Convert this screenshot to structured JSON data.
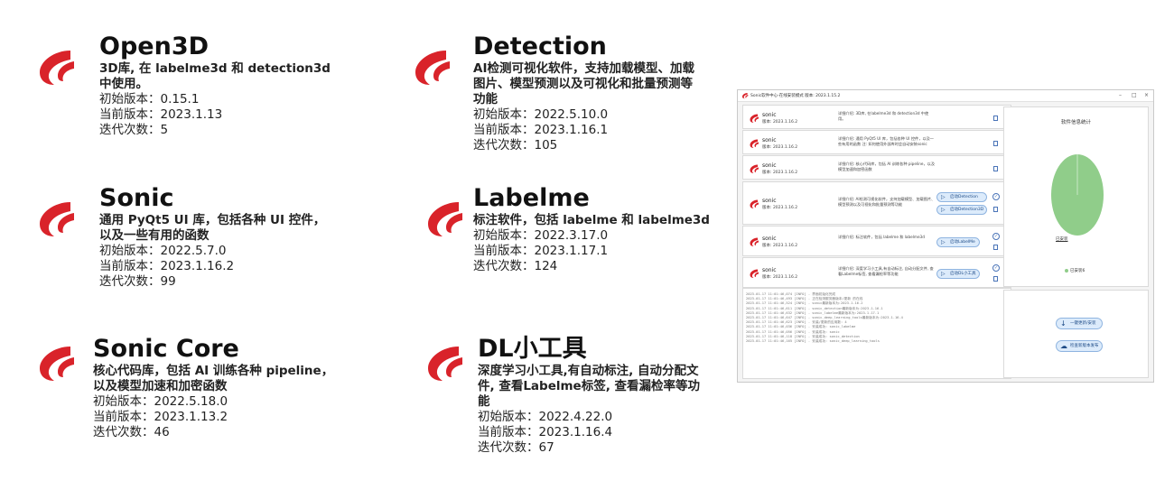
{
  "showcase": [
    {
      "title": "Open3D",
      "desc": "3D库, 在 labelme3d 和 detection3d 中使用。",
      "init_version": "初始版本：0.15.1",
      "current_version": "当前版本：2023.1.13",
      "iterations": "迭代次数：5"
    },
    {
      "title": "Detection",
      "desc": "AI检测可视化软件，支持加载模型、加载图片、模型预测以及可视化和批量预测等功能",
      "init_version": "初始版本：2022.5.10.0",
      "current_version": "当前版本：2023.1.16.1",
      "iterations": "迭代次数：105"
    },
    {
      "title": "Sonic",
      "desc": "通用 PyQt5 UI 库，包括各种 UI 控件，以及一些有用的函数",
      "init_version": "初始版本：2022.5.7.0",
      "current_version": "当前版本：2023.1.16.2",
      "iterations": "迭代次数：99"
    },
    {
      "title": "Labelme",
      "desc": "标注软件，包括 labelme 和 labelme3d",
      "init_version": "初始版本：2022.3.17.0",
      "current_version": "当前版本：2023.1.17.1",
      "iterations": "迭代次数：124"
    },
    {
      "title": "Sonic Core",
      "desc": "核心代码库，包括 AI 训练各种 pipeline，以及模型加速和加密函数",
      "init_version": "初始版本：2022.5.18.0",
      "current_version": "当前版本：2023.1.13.2",
      "iterations": "迭代次数：46"
    },
    {
      "title": "DL小工具",
      "desc": "深度学习小工具,有自动标注, 自动分配文件, 查看Labelme标签, 查看漏检率等功能",
      "init_version": "初始版本：2022.4.22.0",
      "current_version": "当前版本：2023.1.16.4",
      "iterations": "迭代次数：67"
    }
  ],
  "window": {
    "title": "Sonic软件中心-在线安装模式    版本: 2023.1.15.2",
    "controls": [
      "–",
      "□",
      "×"
    ],
    "items": [
      {
        "name": "sonic",
        "version": "版本: 2023.1.16.2",
        "desc": "详细介绍: 3D库, 在labelme3d 和 detection3d 中使用。",
        "buttons": []
      },
      {
        "name": "sonic",
        "version": "版本: 2023.1.16.2",
        "desc": "详细介绍: 通用 PyQt5 UI 库，包括各种 UI 控件，以及一些有用的函数 注: 如何使用外部库时会自动安装sonic",
        "buttons": []
      },
      {
        "name": "sonic",
        "version": "版本: 2023.1.16.2",
        "desc": "详细介绍: 核心代码库，包括 AI 训练各种 pipeline，以及模型加速和加密函数",
        "buttons": []
      },
      {
        "name": "sonic",
        "version": "版本: 2023.1.16.2",
        "desc": "详细介绍: AI检测可视化软件，支持加载模型、加载图片、模型预测以及可视化和批量预测等功能",
        "buttons": [
          "启动Detection",
          "启动Detection3D"
        ]
      },
      {
        "name": "sonic",
        "version": "版本: 2023.1.16.2",
        "desc": "详细介绍: 标注软件，包括 labelme 和 labelme3d",
        "buttons": [
          "启动LabelMe"
        ]
      },
      {
        "name": "sonic",
        "version": "版本: 2023.1.16.2",
        "desc": "详细介绍: 深度学习小工具,有自动标注, 自动分配文件, 查看Labelme标签, 查看漏检率等功能",
        "buttons": [
          "启动DL小工具"
        ]
      }
    ],
    "log": [
      "2023-01-17 11:01:46,074 [INFO] - 界面初始化完成",
      "2023-01-17 11:01:46,493 [INFO] - 正在检测服务器版本/更新 的在线",
      "2023-01-17 11:01:46,524 [INFO] - sonic最新版本为:2023.1.16.2",
      "2023-01-17 11:01:46,611 [INFO] - sonic_detection最新版本为:2023.1.16.1",
      "2023-01-17 11:01:46,632 [INFO] - sonic_labelme最新版本为:2023.1.17.1",
      "2023-01-17 11:01:46,647 [INFO] - sonic_deep_learning_tools最新版本为:2023.1.16.4",
      "2023-01-17 11:01:46,623 [INFO] - 安装/更新的应用数: 4",
      "2023-01-17 11:01:46,036 [INFO] - 安装成功: sonic_labelme",
      "2023-01-17 11:01:46,056 [INFO] - 安装成功: sonic",
      "2023-01-17 11:01:46,118 [INFO] - 安装成功: sonic_detection",
      "2023-01-17 11:01:46,165 [INFO] - 安装成功: sonic_deep_learning_tools"
    ],
    "stats": {
      "title": "软件信息统计",
      "installed_label": "已安装",
      "legend": "已安装6",
      "pie_color": "#90cd8a"
    },
    "actions": {
      "update_all": "一键更新/安装",
      "open_web": "检查新版本发布"
    }
  }
}
